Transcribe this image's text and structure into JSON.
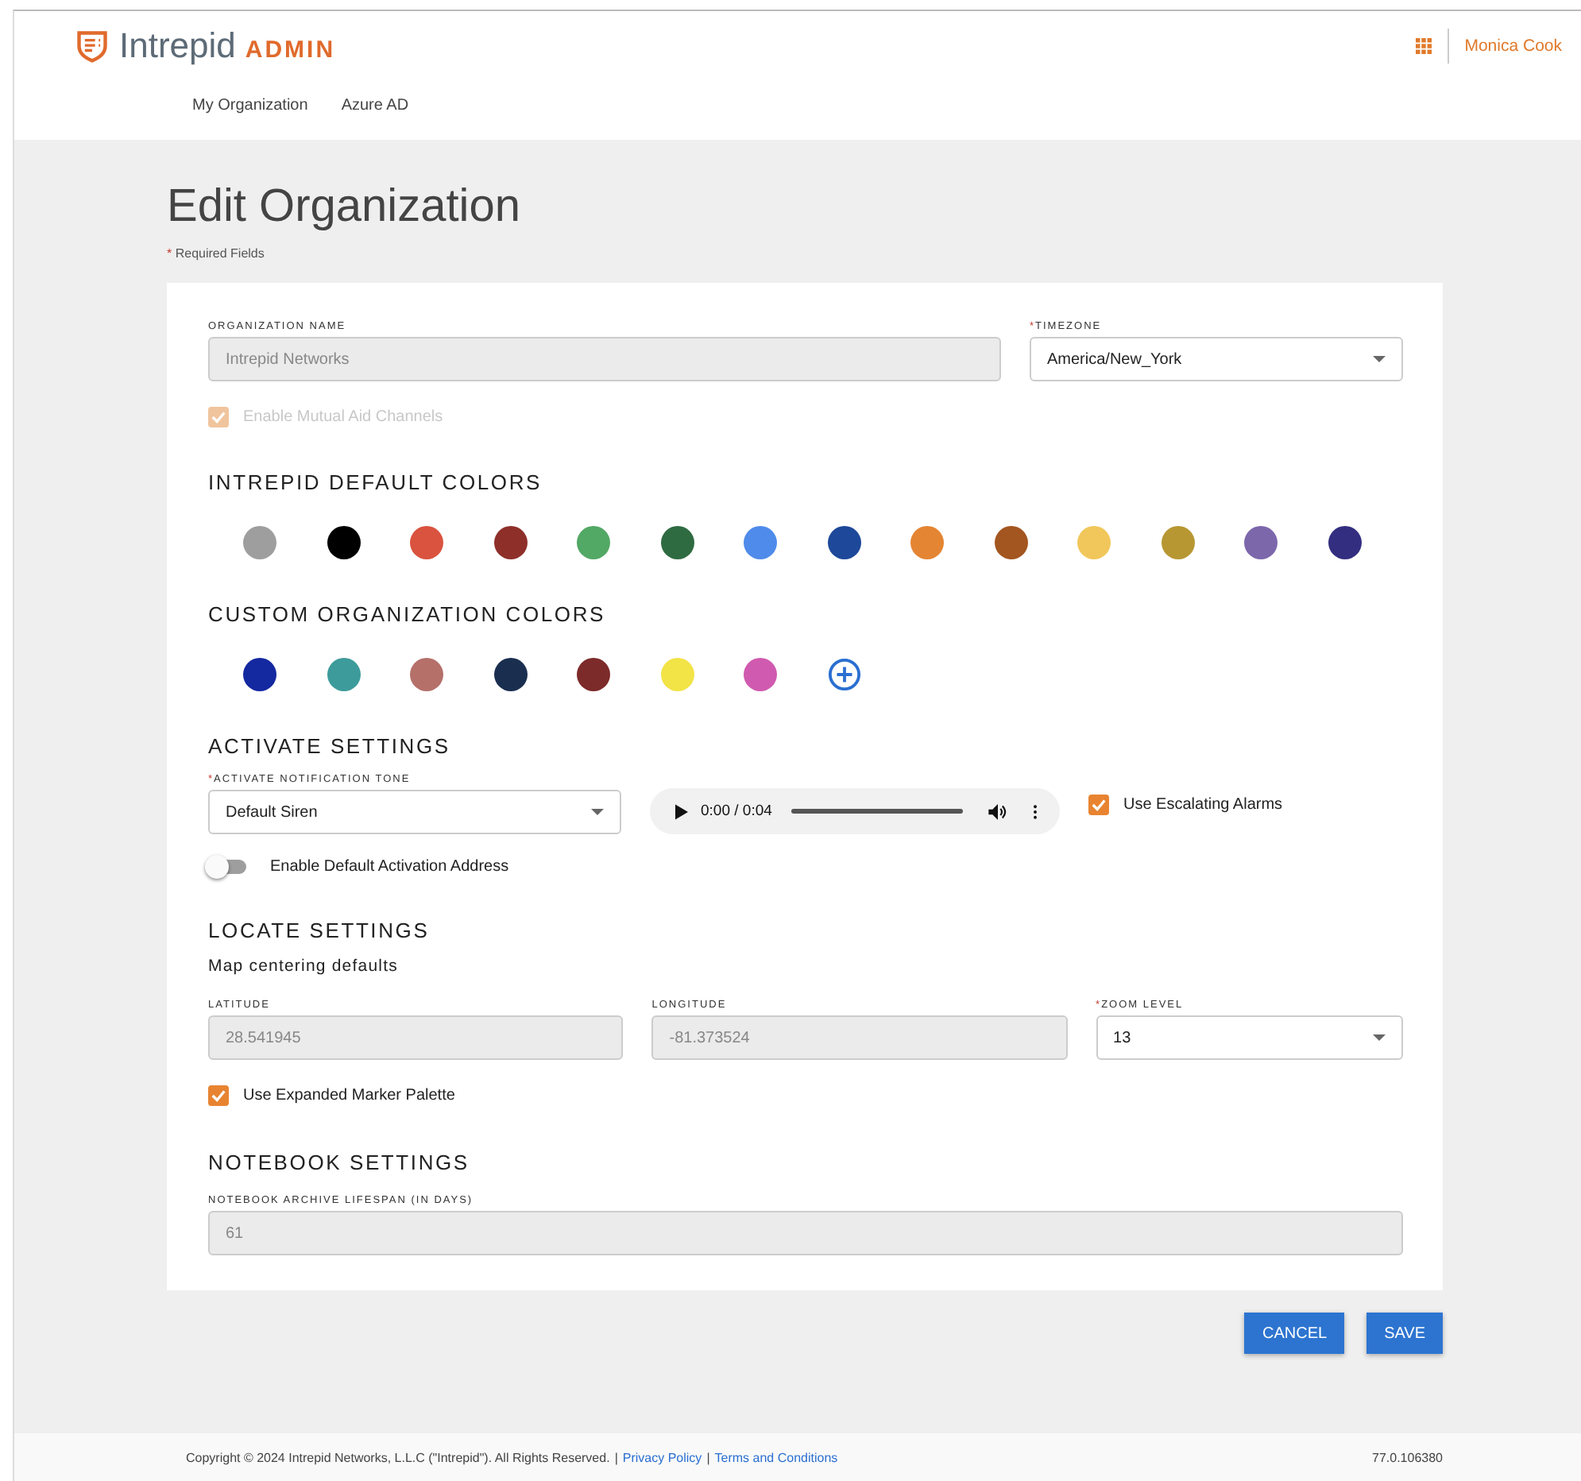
{
  "header": {
    "brand": "Intrepid",
    "product": "ADMIN",
    "user": "Monica Cook",
    "nav": [
      "My Organization",
      "Azure AD"
    ]
  },
  "page": {
    "title": "Edit Organization",
    "required_note": {
      "marker": "*",
      "text": "Required Fields"
    }
  },
  "general": {
    "fields": [
      {
        "kind": "text",
        "label": "ORGANIZATION NAME",
        "value": "Intrepid Networks",
        "disabled": true,
        "required": false
      },
      {
        "kind": "select",
        "label": "TIMEZONE",
        "value": "America/New_York",
        "disabled": false,
        "required": true,
        "marker": "*"
      }
    ],
    "mutual_aid": {
      "label": "Enable Mutual Aid Channels",
      "checked": true,
      "disabled": true
    }
  },
  "default_colors": {
    "title": "INTREPID DEFAULT COLORS",
    "colors": [
      {
        "color": "#9e9e9e"
      },
      {
        "color": "#000000"
      },
      {
        "color": "#d9533f"
      },
      {
        "color": "#8e2f2a"
      },
      {
        "color": "#52a865"
      },
      {
        "color": "#2f6b41"
      },
      {
        "color": "#4f8bea"
      },
      {
        "color": "#1e4899"
      },
      {
        "color": "#e48533"
      },
      {
        "color": "#a3561f"
      },
      {
        "color": "#f1c75b"
      },
      {
        "color": "#b79732"
      },
      {
        "color": "#7c67ab"
      },
      {
        "color": "#342e80"
      }
    ]
  },
  "custom_colors": {
    "title": "CUSTOM ORGANIZATION COLORS",
    "colors": [
      {
        "color": "#1428a0"
      },
      {
        "color": "#3d9b9b"
      },
      {
        "color": "#b5706a"
      },
      {
        "color": "#1a2e4f"
      },
      {
        "color": "#7d2a2a"
      },
      {
        "color": "#f2e346"
      },
      {
        "color": "#d05aaf"
      }
    ]
  },
  "activate": {
    "title": "ACTIVATE SETTINGS",
    "tone": {
      "label": "ACTIVATE NOTIFICATION TONE",
      "marker": "*",
      "value": "Default Siren"
    },
    "audio": {
      "time": "0:00 / 0:04"
    },
    "escalating": {
      "label": "Use Escalating Alarms",
      "checked": true,
      "disabled": false
    },
    "address_toggle": {
      "label": "Enable Default Activation Address",
      "on": false
    }
  },
  "locate": {
    "title": "LOCATE SETTINGS",
    "subtitle": "Map centering defaults",
    "fields": [
      {
        "kind": "text",
        "label": "LATITUDE",
        "value": "28.541945",
        "disabled": true,
        "required": false
      },
      {
        "kind": "text",
        "label": "LONGITUDE",
        "value": "-81.373524",
        "disabled": true,
        "required": false
      },
      {
        "kind": "select",
        "label": "ZOOM LEVEL",
        "value": "13",
        "disabled": false,
        "required": true,
        "marker": "*"
      }
    ],
    "expanded_palette": {
      "label": "Use Expanded Marker Palette",
      "checked": true,
      "disabled": false
    }
  },
  "notebook": {
    "title": "NOTEBOOK SETTINGS",
    "fields": [
      {
        "label": "NOTEBOOK ARCHIVE LIFESPAN (IN DAYS)",
        "value": "61",
        "disabled": true
      }
    ]
  },
  "buttons": [
    "CANCEL",
    "SAVE"
  ],
  "footer": {
    "copyright": "Copyright © 2024 Intrepid Networks, L.L.C (\"Intrepid\"). All Rights Reserved.",
    "separator": "|",
    "links": [
      "Privacy Policy",
      "Terms and Conditions"
    ],
    "version": "77.0.106380"
  }
}
